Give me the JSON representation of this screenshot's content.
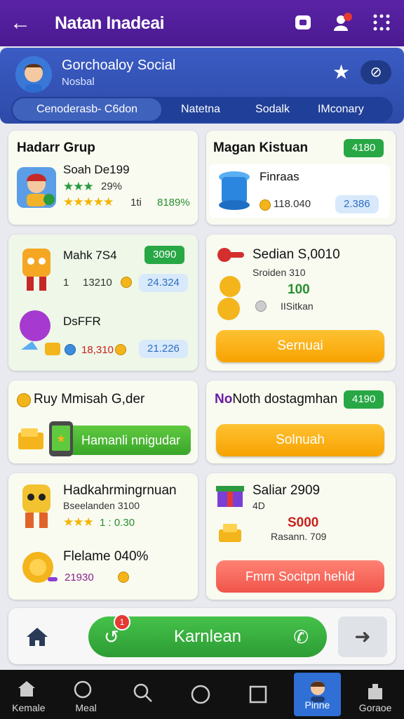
{
  "header": {
    "title": "Natan Inadeai"
  },
  "profile": {
    "name": "Gorchoaloy Social",
    "subtitle": "Nosbal",
    "tabs": [
      "Cenoderasb- C6don",
      "Natetna",
      "Sodalk",
      "IMconary"
    ]
  },
  "cards": {
    "c1": {
      "heading": "Hadarr Grup",
      "item": "Soah De199",
      "stat": "29%",
      "rating_text": "1ti",
      "green_value": "8189%"
    },
    "c2": {
      "heading": "Magan Kistuan",
      "badge": "4180",
      "item": "Finraas",
      "value": "118.040",
      "pill": "2.386"
    },
    "c3": {
      "item1": "Mahk 7S4",
      "badge": "3090",
      "value1": "13210",
      "value1_prefix": "1",
      "pill1": "24.324",
      "item2": "DsFFR",
      "value2": "18,310",
      "pill2": "21.226"
    },
    "c4": {
      "heading": "Sedian S,0010",
      "subtitle": "Sroiden 310",
      "value": "100",
      "small": "IISitkan",
      "button": "Sernuai"
    },
    "c5": {
      "heading": "Ruy Mmisah G,der",
      "button": "Hamanli nnigudar"
    },
    "c6": {
      "heading": "Noth dostagmhan",
      "badge": "4190",
      "button": "Solnuah"
    },
    "c7": {
      "item1": "Hadkahrmingrnuan",
      "sub1": "Bseelanden 3100",
      "rating1": "1 : 0.30",
      "item2": "Flelame 040%",
      "value2": "21930"
    },
    "c8": {
      "heading": "Saliar 2909",
      "sub": "4D",
      "value": "S000",
      "small": "Rasann. 709",
      "button": "Fmrn Socitpn hehld"
    }
  },
  "bottom_action": {
    "label": "Karnlean",
    "notif": "1"
  },
  "nav": [
    "Kemale",
    "Meal",
    "",
    "",
    "",
    "Pinne",
    "Goraoe"
  ],
  "colors": {
    "header": "#5a23a6",
    "profile": "#3b5cc4",
    "green": "#28a745",
    "orange": "#f7a200",
    "red": "#f0554a"
  },
  "icons": [
    "back-arrow-icon",
    "camera-icon",
    "notification-icon",
    "grid-menu-icon",
    "star-icon",
    "eye-off-icon",
    "phone-icon",
    "arrow-right-icon",
    "home-icon",
    "search-icon",
    "circle-icon",
    "square-icon",
    "profile-icon",
    "store-icon"
  ]
}
